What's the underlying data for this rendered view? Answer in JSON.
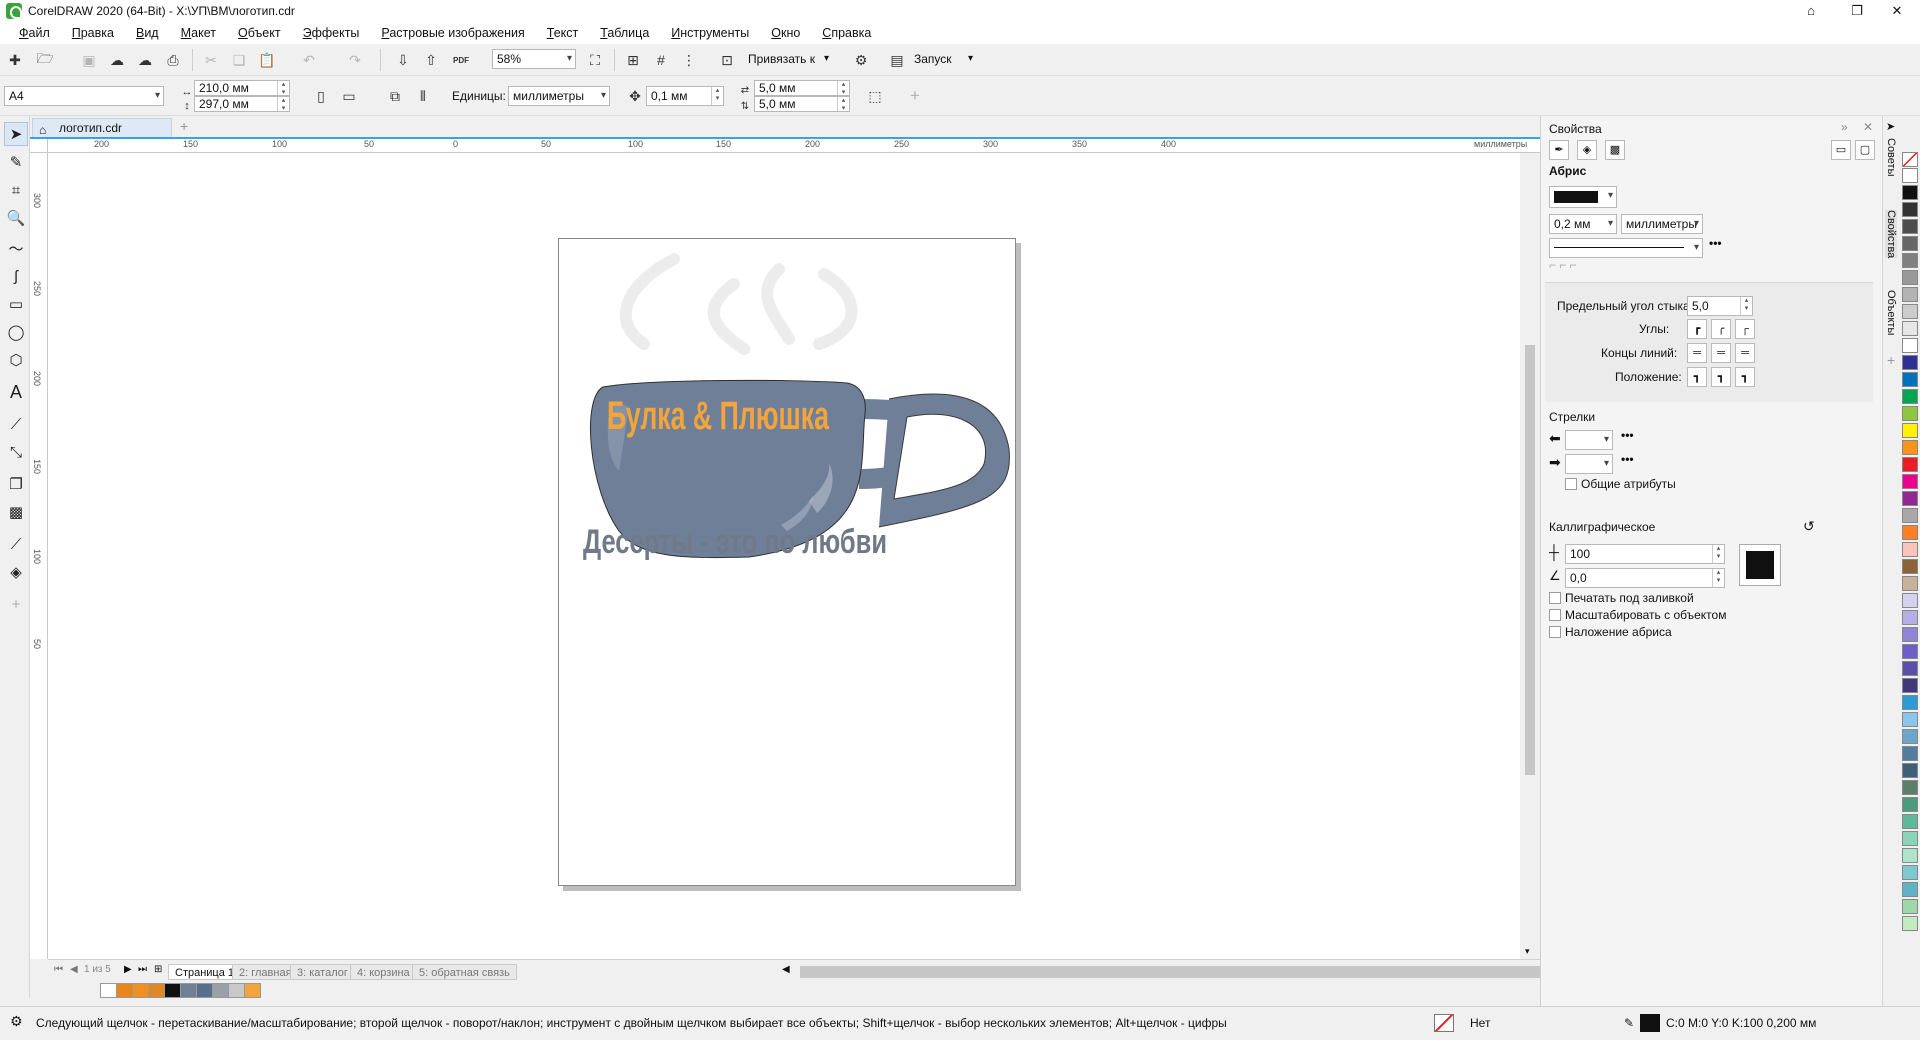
{
  "window": {
    "title": "CorelDRAW 2020 (64-Bit) - X:\\УП\\ВМ\\логотип.cdr"
  },
  "menu": [
    "Файл",
    "Правка",
    "Вид",
    "Макет",
    "Объект",
    "Эффекты",
    "Растровые изображения",
    "Текст",
    "Таблица",
    "Инструменты",
    "Окно",
    "Справка"
  ],
  "toolbar": {
    "zoom": "58%",
    "snap_label": "Привязать к",
    "launch_label": "Запуск",
    "pdf_label": "PDF"
  },
  "propbar": {
    "page_size": "A4",
    "width": "210,0 мм",
    "height": "297,0 мм",
    "units_label": "Единицы:",
    "units_value": "миллиметры",
    "nudge": "0,1 мм",
    "dup_x": "5,0 мм",
    "dup_y": "5,0 мм"
  },
  "document": {
    "tab_name": "логотип.cdr",
    "ruler_unit": "миллиметры",
    "ruler_h_ticks": [
      "200",
      "150",
      "100",
      "50",
      "0",
      "50",
      "100",
      "150",
      "200",
      "250",
      "300",
      "350",
      "400"
    ],
    "ruler_v_ticks": [
      "300",
      "250",
      "200",
      "150",
      "100",
      "50"
    ],
    "logo_title": "Булка & Плюшка",
    "logo_tagline": "Десерты - это по любви"
  },
  "pages": {
    "nav": "1 из 5",
    "tabs": [
      "Страница 1",
      "2: главная",
      "3: каталог",
      "4: корзина",
      "5: обратная связь"
    ]
  },
  "docker": {
    "title": "Свойства",
    "outline": {
      "heading": "Абрис",
      "width": "0,2 мм",
      "units": "миллиметры",
      "miter_label": "Предельный угол стыка:",
      "miter_value": "5,0",
      "corners_label": "Углы:",
      "caps_label": "Концы линий:",
      "position_label": "Положение:"
    },
    "arrows": {
      "heading": "Стрелки",
      "shared_label": "Общие атрибуты"
    },
    "calligraphic": {
      "heading": "Каллиграфическое",
      "stretch": "100",
      "angle": "0,0",
      "opt1": "Печатать под заливкой",
      "opt2": "Масштабировать с объектом",
      "opt3": "Наложение абриса"
    }
  },
  "vtabs": [
    "Советы",
    "Свойства",
    "Объекты"
  ],
  "status": {
    "hint": "Следующий щелчок - перетаскивание/масштабирование; второй щелчок - поворот/наклон; инструмент с двойным щелчком выбирает все объекты; Shift+щелчок - выбор нескольких элементов; Alt+щелчок - цифры",
    "fill": "Нет",
    "outline": "C:0 M:0 Y:0 K:100  0,200 мм"
  },
  "colors": {
    "accent_orange": "#f3a43b",
    "cup_gray": "#6f7f98",
    "tagline_gray": "#707987",
    "selection_blue": "#36a3e8"
  },
  "doc_palette": [
    "#ffffff",
    "#e8861a",
    "#f09020",
    "#e08828",
    "#111111",
    "#6f7f98",
    "#5a6e8c",
    "#9aa0a8",
    "#c8c8c8",
    "#f3a43b"
  ],
  "palette": [
    "#ffffff",
    "#111111",
    "#333333",
    "#4d4d4d",
    "#666666",
    "#808080",
    "#999999",
    "#b3b3b3",
    "#cccccc",
    "#e6e6e6",
    "#ffffff",
    "#2e3192",
    "#0072bc",
    "#00a651",
    "#8dc63f",
    "#fff200",
    "#f7941d",
    "#ed1c24",
    "#ec008c",
    "#92278f",
    "#a8a8a8",
    "#ff7f27",
    "#f9c4b8",
    "#8c6239",
    "#c7b299",
    "#d4d0f0",
    "#b6aee6",
    "#8f84d6",
    "#6c5fc7",
    "#5b4fa8",
    "#40387a",
    "#2b9bd8",
    "#8ac6e8",
    "#6ea6c8",
    "#4f7e9e",
    "#3d5f78",
    "#5d7f6a",
    "#4a9c7a",
    "#5fb89a",
    "#8ad4b8",
    "#aee3cc",
    "#7ec8d0",
    "#5fb3c4",
    "#9fd7a8",
    "#c4ebc0"
  ]
}
